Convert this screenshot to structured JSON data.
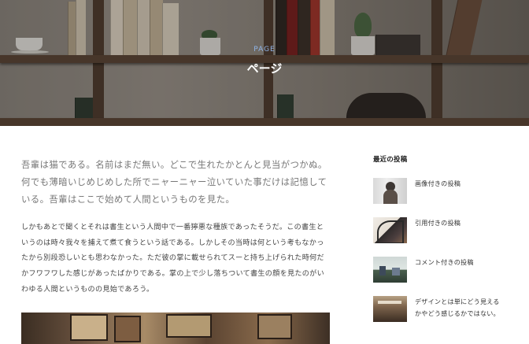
{
  "hero": {
    "label": "PAGE",
    "title": "ページ"
  },
  "main": {
    "lead": "吾輩は猫である。名前はまだ無い。どこで生れたかとんと見当がつかぬ。何でも薄暗いじめじめした所でニャーニャー泣いていた事だけは記憶している。吾輩はここで始めて人間というものを見た。",
    "body": "しかもあとで聞くとそれは書生という人間中で一番獰悪な種族であったそうだ。この書生というのは時々我々を捕えて煮て食うという話である。しかしその当時は何という考もなかったから別段恐しいとも思わなかった。ただ彼の掌に載せられてスーと持ち上げられた時何だかフワフワした感じがあったばかりである。掌の上で少し落ちついて書生の顔を見たのがいわゆる人間というものの見始であろう。"
  },
  "sidebar": {
    "title": "最近の投稿",
    "posts": [
      {
        "title": "画像付きの投稿"
      },
      {
        "title": "引用付きの投稿"
      },
      {
        "title": "コメント付きの投稿"
      },
      {
        "title": "デザインとは単にどう見えるかやどう感じるかではない。"
      }
    ]
  }
}
